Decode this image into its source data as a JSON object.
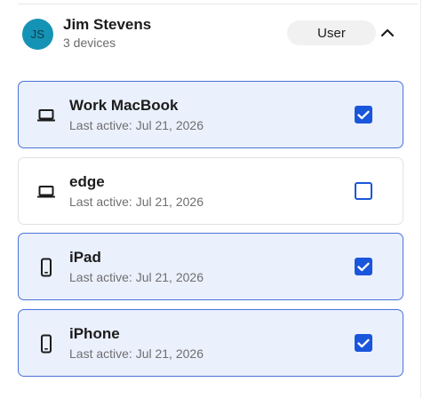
{
  "user": {
    "initials": "JS",
    "name": "Jim Stevens",
    "device_count_text": "3 devices",
    "role": "User",
    "avatar_color": "#1593b5"
  },
  "accent_color": "#1a56db",
  "icons": {
    "collapse": "chevron-up-icon",
    "laptop": "laptop-icon",
    "phone": "phone-icon"
  },
  "devices": [
    {
      "name": "Work MacBook",
      "last_active": "Last active: Jul 21, 2026",
      "type": "laptop",
      "checked": true
    },
    {
      "name": "edge",
      "last_active": "Last active: Jul 21, 2026",
      "type": "laptop",
      "checked": false
    },
    {
      "name": "iPad",
      "last_active": "Last active: Jul 21, 2026",
      "type": "phone",
      "checked": true
    },
    {
      "name": "iPhone",
      "last_active": "Last active: Jul 21, 2026",
      "type": "phone",
      "checked": true
    }
  ]
}
